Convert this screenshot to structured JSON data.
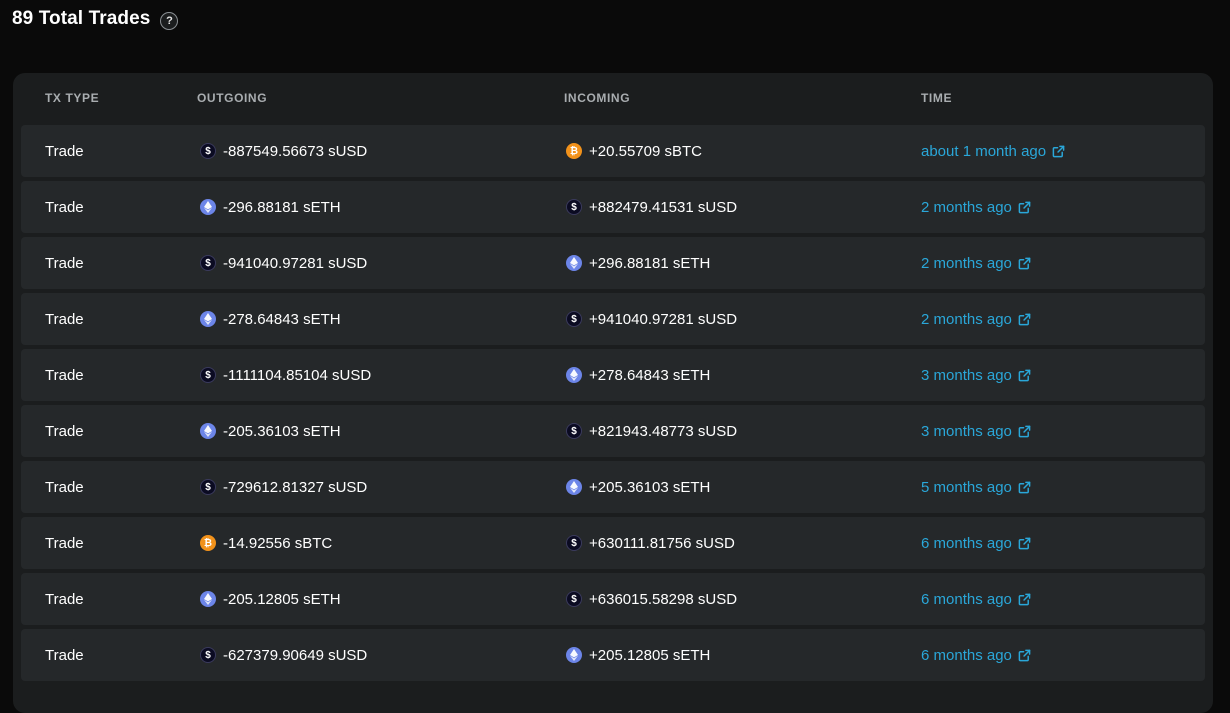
{
  "header": {
    "title": "89 Total Trades",
    "help_glyph": "?"
  },
  "table": {
    "columns": {
      "type": "TX TYPE",
      "outgoing": "OUTGOING",
      "incoming": "INCOMING",
      "time": "TIME"
    },
    "rows": [
      {
        "type": "Trade",
        "out": {
          "amount": "-887549.56673 sUSD",
          "coin": "sUSD"
        },
        "in": {
          "amount": "+20.55709 sBTC",
          "coin": "sBTC"
        },
        "time": "about 1 month ago"
      },
      {
        "type": "Trade",
        "out": {
          "amount": "-296.88181 sETH",
          "coin": "sETH"
        },
        "in": {
          "amount": "+882479.41531 sUSD",
          "coin": "sUSD"
        },
        "time": "2 months ago"
      },
      {
        "type": "Trade",
        "out": {
          "amount": "-941040.97281 sUSD",
          "coin": "sUSD"
        },
        "in": {
          "amount": "+296.88181 sETH",
          "coin": "sETH"
        },
        "time": "2 months ago"
      },
      {
        "type": "Trade",
        "out": {
          "amount": "-278.64843 sETH",
          "coin": "sETH"
        },
        "in": {
          "amount": "+941040.97281 sUSD",
          "coin": "sUSD"
        },
        "time": "2 months ago"
      },
      {
        "type": "Trade",
        "out": {
          "amount": "-1111104.85104 sUSD",
          "coin": "sUSD"
        },
        "in": {
          "amount": "+278.64843 sETH",
          "coin": "sETH"
        },
        "time": "3 months ago"
      },
      {
        "type": "Trade",
        "out": {
          "amount": "-205.36103 sETH",
          "coin": "sETH"
        },
        "in": {
          "amount": "+821943.48773 sUSD",
          "coin": "sUSD"
        },
        "time": "3 months ago"
      },
      {
        "type": "Trade",
        "out": {
          "amount": "-729612.81327 sUSD",
          "coin": "sUSD"
        },
        "in": {
          "amount": "+205.36103 sETH",
          "coin": "sETH"
        },
        "time": "5 months ago"
      },
      {
        "type": "Trade",
        "out": {
          "amount": "-14.92556 sBTC",
          "coin": "sBTC"
        },
        "in": {
          "amount": "+630111.81756 sUSD",
          "coin": "sUSD"
        },
        "time": "6 months ago"
      },
      {
        "type": "Trade",
        "out": {
          "amount": "-205.12805 sETH",
          "coin": "sETH"
        },
        "in": {
          "amount": "+636015.58298 sUSD",
          "coin": "sUSD"
        },
        "time": "6 months ago"
      },
      {
        "type": "Trade",
        "out": {
          "amount": "-627379.90649 sUSD",
          "coin": "sUSD"
        },
        "in": {
          "amount": "+205.12805 sETH",
          "coin": "sETH"
        },
        "time": "6 months ago"
      }
    ]
  },
  "icons": {
    "sUSD": "susd-coin-icon",
    "sETH": "seth-coin-icon",
    "sBTC": "sbtc-coin-icon",
    "external": "external-link-icon"
  },
  "colors": {
    "page_bg": "#0a0a0a",
    "panel_bg": "#1b1d1e",
    "row_bg": "#25282a",
    "link": "#2aa7d9",
    "sbtc": "#f2921b",
    "seth": "#6c85e8",
    "susd": "#0b0b22"
  }
}
